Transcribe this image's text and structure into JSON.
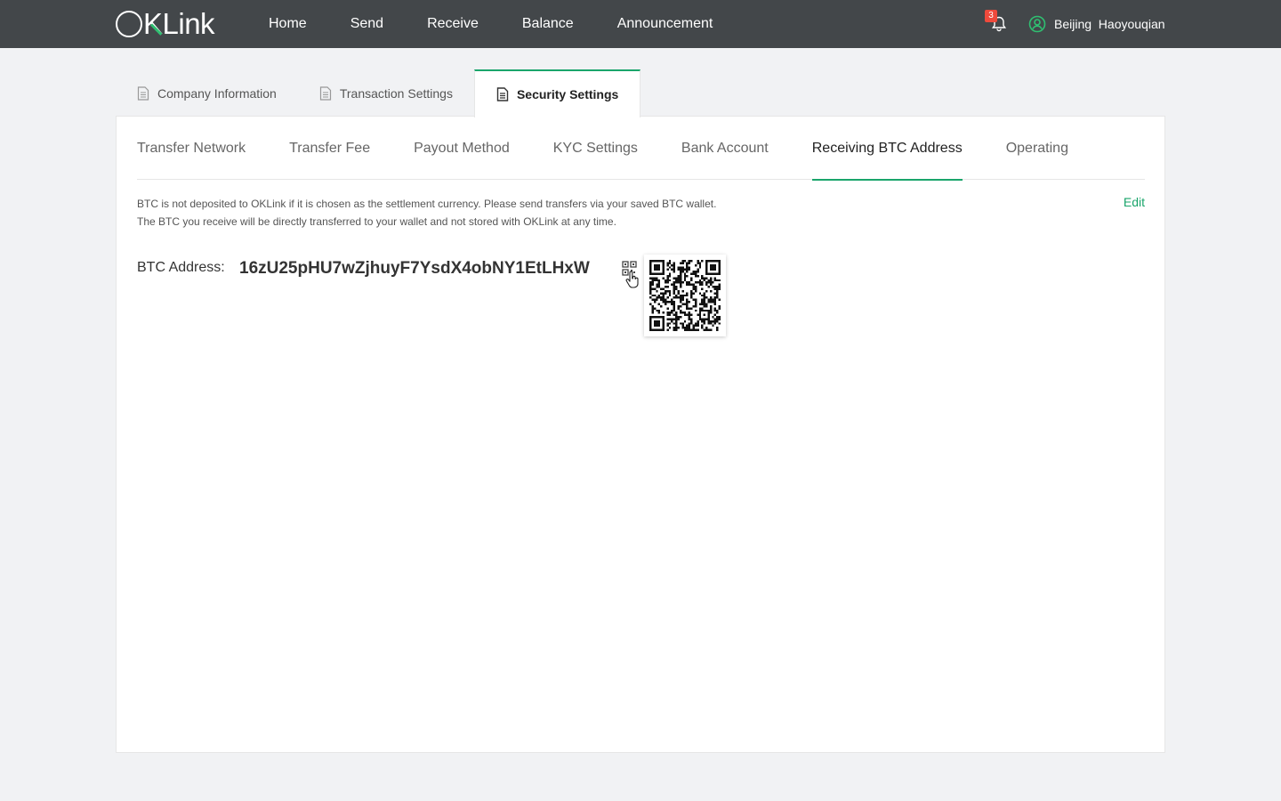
{
  "header": {
    "logo": {
      "o": "O",
      "k": "K",
      "rest": "Link",
      "accent": "#2fbf71"
    },
    "nav": [
      "Home",
      "Send",
      "Receive",
      "Balance",
      "Announcement"
    ],
    "notifications": {
      "count": "3",
      "icon": "bell-icon"
    },
    "user": {
      "name": "Beijing  Haoyouqian",
      "icon": "user-circle-icon"
    }
  },
  "outer_tabs": [
    {
      "label": "Company Information",
      "icon": "document-icon",
      "active": false
    },
    {
      "label": "Transaction Settings",
      "icon": "document-icon",
      "active": false
    },
    {
      "label": "Security Settings",
      "icon": "document-icon",
      "active": true
    }
  ],
  "sub_tabs": [
    {
      "label": "Transfer Network",
      "active": false
    },
    {
      "label": "Transfer Fee",
      "active": false
    },
    {
      "label": "Payout Method",
      "active": false
    },
    {
      "label": "KYC Settings",
      "active": false
    },
    {
      "label": "Bank Account",
      "active": false
    },
    {
      "label": "Receiving BTC Address",
      "active": true
    },
    {
      "label": "Operating",
      "active": false
    }
  ],
  "content": {
    "note_line1": "BTC is not deposited to OKLink if it is chosen as the settlement currency. Please send transfers via your saved BTC wallet.",
    "note_line2": "The BTC you receive will be directly transferred to your wallet and not stored with OKLink at any time.",
    "edit_label": "Edit",
    "address_label": "BTC Address:",
    "address_value": "16zU25pHU7wZjhuyF7YsdX4obNY1EtLHxW"
  },
  "colors": {
    "accent": "#1aa56b",
    "topbar": "#43474a",
    "badge": "#ef4a3c"
  }
}
